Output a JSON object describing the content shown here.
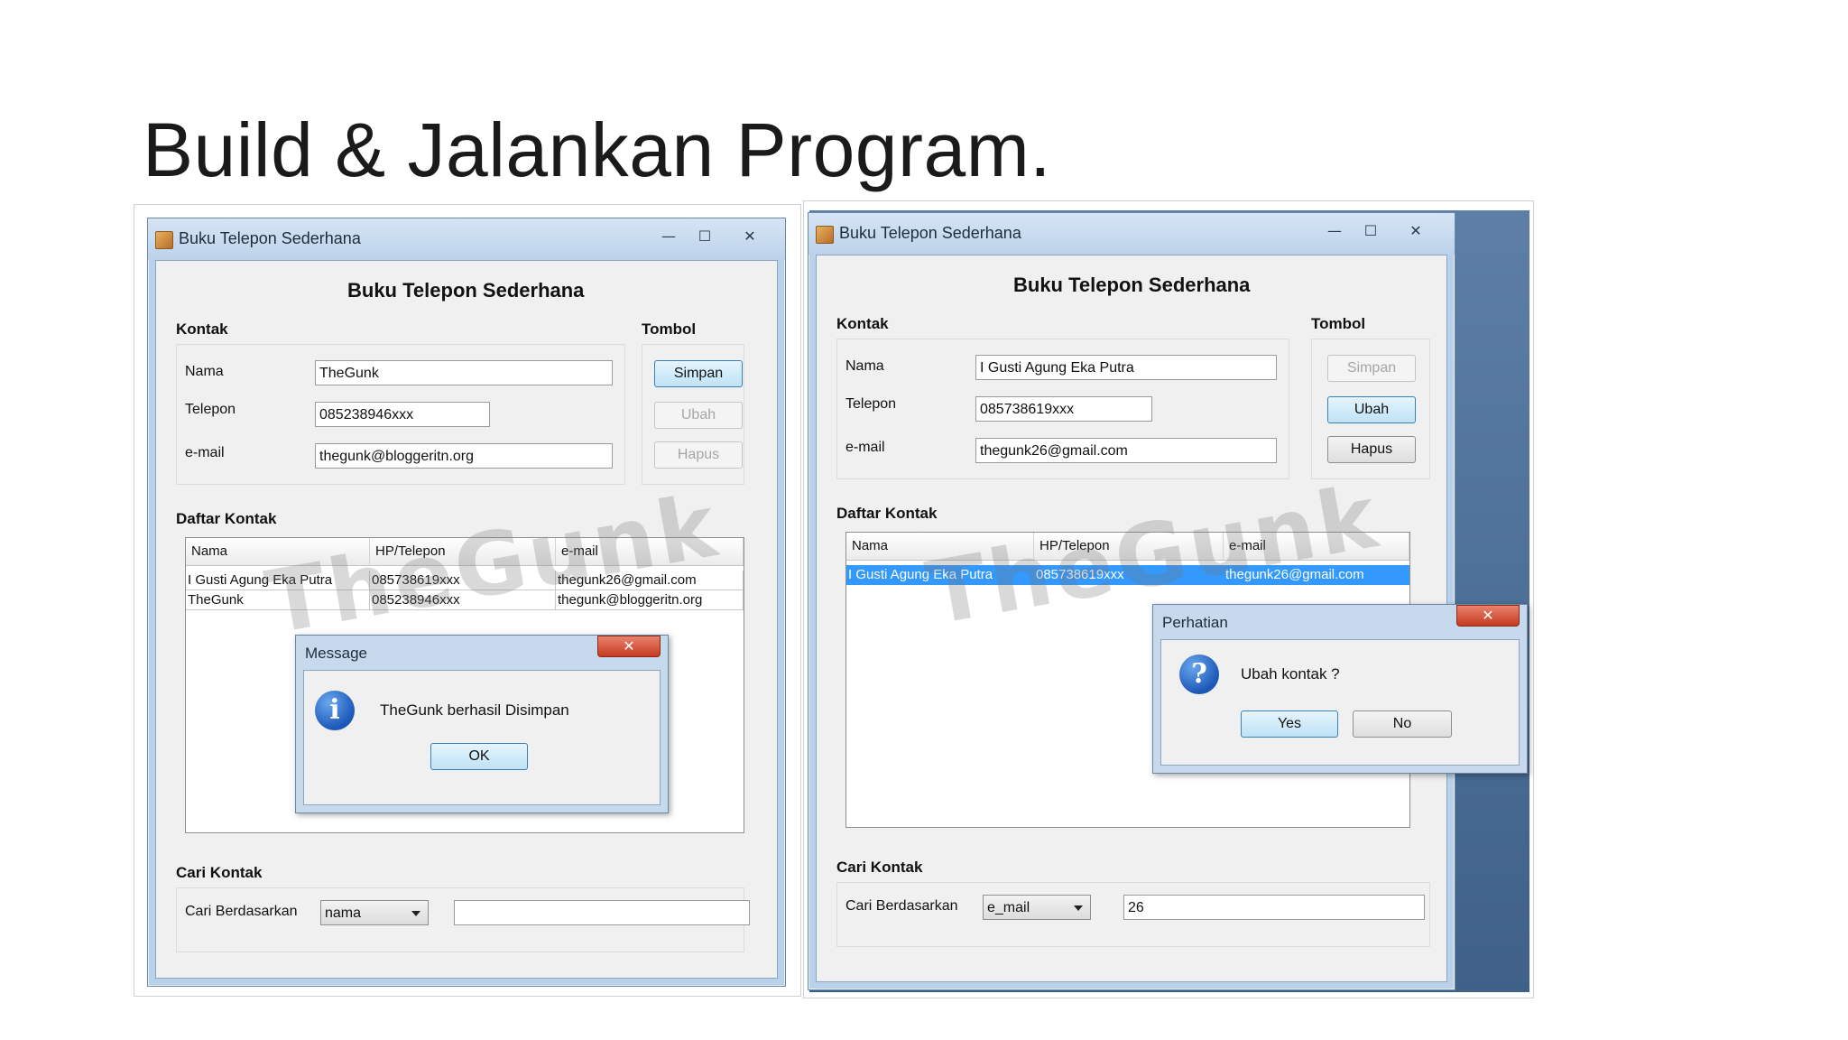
{
  "slide": {
    "title": "Build & Jalankan Program."
  },
  "window": {
    "title": "Buku Telepon Sederhana",
    "heading": "Buku Telepon Sederhana"
  },
  "labels": {
    "kontak": "Kontak",
    "tombol": "Tombol",
    "nama": "Nama",
    "telepon": "Telepon",
    "email": "e-mail",
    "daftar_kontak": "Daftar Kontak",
    "cari_kontak": "Cari Kontak",
    "cari_berdasarkan": "Cari Berdasarkan"
  },
  "buttons": {
    "simpan": "Simpan",
    "ubah": "Ubah",
    "hapus": "Hapus"
  },
  "table_headers": [
    "Nama",
    "HP/Telepon",
    "e-mail"
  ],
  "watermark": "TheGunk",
  "left": {
    "fields": {
      "nama": "TheGunk",
      "telepon": "085238946xxx",
      "email": "thegunk@bloggeritn.org"
    },
    "rows": [
      [
        "I Gusti Agung Eka Putra",
        "085738619xxx",
        "thegunk26@gmail.com"
      ],
      [
        "TheGunk",
        "085238946xxx",
        "thegunk@bloggeritn.org"
      ]
    ],
    "search": {
      "by": "nama",
      "query": ""
    },
    "dialog": {
      "title": "Message",
      "message": "TheGunk berhasil Disimpan",
      "ok": "OK",
      "icon": "info-icon"
    }
  },
  "right": {
    "fields": {
      "nama": "I Gusti Agung Eka Putra",
      "telepon": "085738619xxx",
      "email": "thegunk26@gmail.com"
    },
    "rows": [
      [
        "I Gusti Agung Eka Putra",
        "085738619xxx",
        "thegunk26@gmail.com"
      ]
    ],
    "search": {
      "by": "e_mail",
      "query": "26"
    },
    "dialog": {
      "title": "Perhatian",
      "message": "Ubah kontak ?",
      "yes": "Yes",
      "no": "No",
      "icon": "question-icon"
    }
  },
  "colors": {
    "selection": "#3399ff",
    "titlebar": "#bcd2ea",
    "desktop": "#4a6d94"
  }
}
